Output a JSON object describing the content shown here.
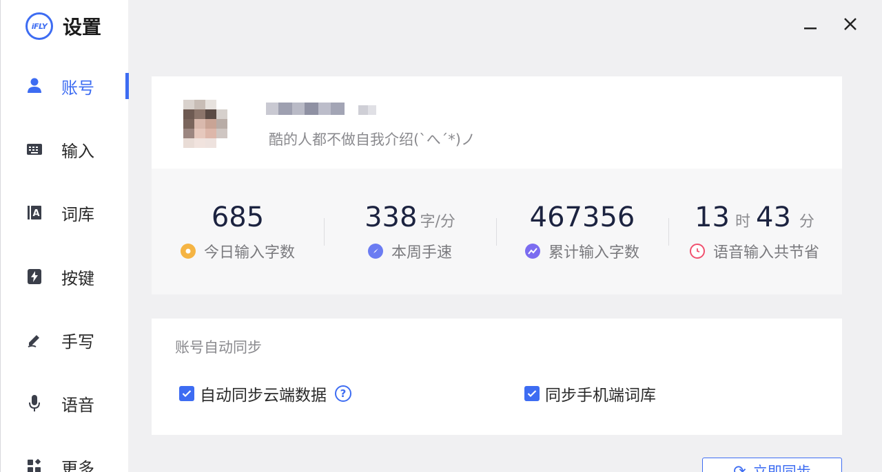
{
  "app": {
    "logo_text": "iFLY",
    "title": "设置"
  },
  "sidebar": {
    "items": [
      {
        "label": "账号",
        "icon": "user-icon",
        "active": true
      },
      {
        "label": "输入",
        "icon": "keyboard-icon"
      },
      {
        "label": "词库",
        "icon": "lexicon-icon"
      },
      {
        "label": "按键",
        "icon": "lightning-icon"
      },
      {
        "label": "手写",
        "icon": "pen-icon"
      },
      {
        "label": "语音",
        "icon": "microphone-icon"
      },
      {
        "label": "更多",
        "icon": "grid-icon"
      }
    ]
  },
  "window": {
    "minimize_icon": "minimize-icon",
    "close_icon": "close-icon"
  },
  "profile": {
    "signature": "酷的人都不做自我介绍(`へ´*)ノ"
  },
  "stats": [
    {
      "value": "685",
      "label": "今日输入字数",
      "icon": "sun-icon",
      "color": "#f5b443"
    },
    {
      "value": "338",
      "unit": "字/分",
      "label": "本周手速",
      "icon": "rocket-icon",
      "color": "#6b7cf2"
    },
    {
      "value": "467356",
      "label": "累计输入字数",
      "icon": "trend-icon",
      "color": "#7b6cf0"
    },
    {
      "hours": "13",
      "hours_unit": "时",
      "minutes": "43",
      "minutes_unit": "分",
      "label": "语音输入共节省",
      "icon": "clock-icon",
      "color": "#f0506e"
    }
  ],
  "sync": {
    "title": "账号自动同步",
    "options": [
      {
        "label": "自动同步云端数据",
        "checked": true,
        "help": "?"
      },
      {
        "label": "同步手机端词库",
        "checked": true
      }
    ],
    "button_label": "立即同步"
  },
  "colors": {
    "accent": "#3d6cf2",
    "sidebar_bg": "#ffffff",
    "page_bg": "#f0f0f2"
  }
}
